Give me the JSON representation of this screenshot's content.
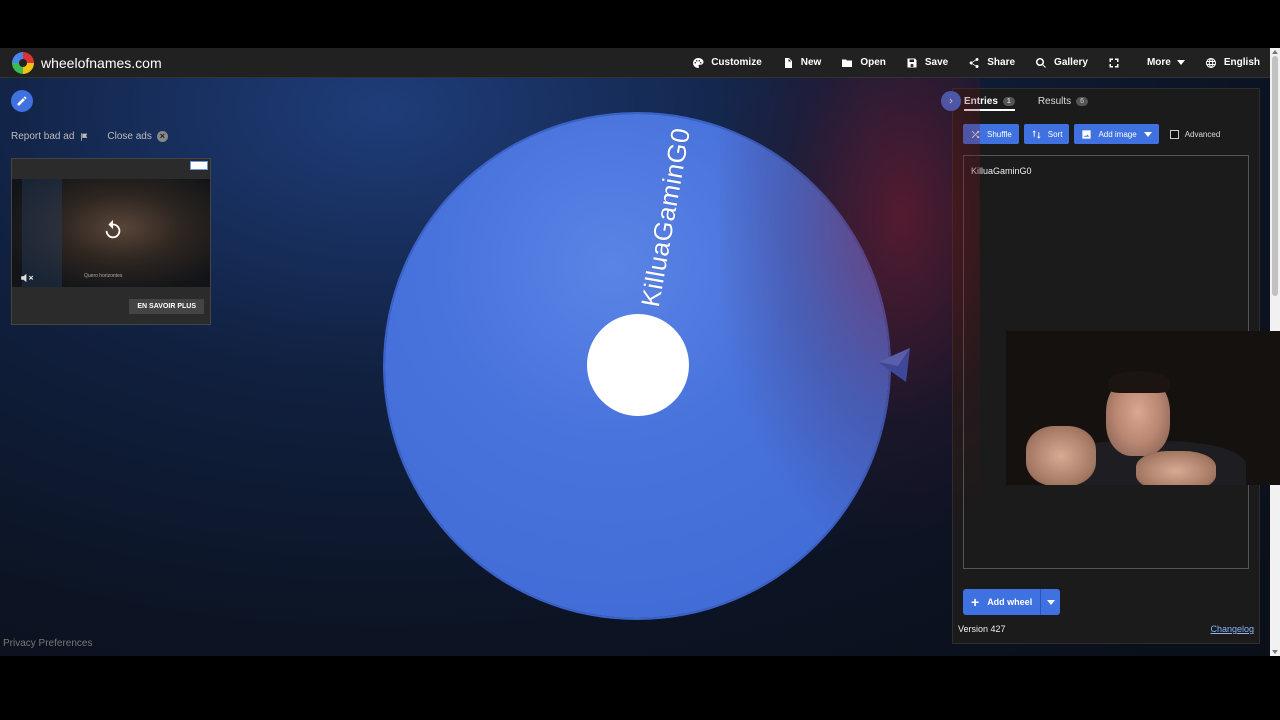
{
  "site": {
    "name": "wheelofnames.com"
  },
  "nav": [
    {
      "label": "Customize",
      "icon": "palette-icon"
    },
    {
      "label": "New",
      "icon": "file-icon"
    },
    {
      "label": "Open",
      "icon": "folder-icon"
    },
    {
      "label": "Save",
      "icon": "save-icon"
    },
    {
      "label": "Share",
      "icon": "share-icon"
    },
    {
      "label": "Gallery",
      "icon": "search-icon"
    },
    {
      "label": "",
      "icon": "fullscreen-icon"
    },
    {
      "label": "More",
      "icon": "caret-down-icon"
    },
    {
      "label": "English",
      "icon": "globe-icon"
    }
  ],
  "ads": {
    "report_label": "Report bad ad",
    "close_label": "Close ads",
    "video_caption": "Quero horizontes",
    "cta_label": "EN SAVOIR PLUS"
  },
  "wheel": {
    "entries": [
      "KilluaGaminG0"
    ],
    "color": "#4873dc"
  },
  "panel": {
    "tabs": [
      {
        "label": "Entries",
        "count": "1"
      },
      {
        "label": "Results",
        "count": "6"
      }
    ],
    "toolbar": {
      "shuffle_label": "Shuffle",
      "sort_label": "Sort",
      "add_image_label": "Add image",
      "advanced_label": "Advanced"
    },
    "entries_text": "KilluaGaminG0",
    "add_wheel_label": "Add wheel",
    "version_label": "Version 427",
    "changelog_label": "Changelog"
  },
  "footer": {
    "privacy_label": "Privacy Preferences"
  },
  "colors": {
    "accent": "#3f72e0",
    "header_bg": "#212121",
    "panel_bg": "#1b1b1b"
  }
}
